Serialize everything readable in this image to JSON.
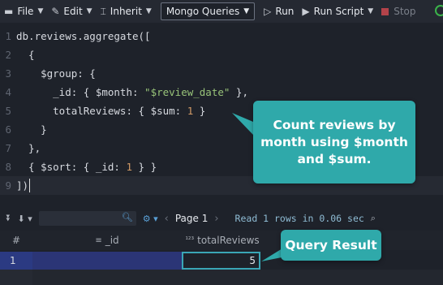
{
  "toolbar": {
    "file_label": "File",
    "edit_label": "Edit",
    "inherit_label": "Inherit",
    "query_mode": "Mongo Queries",
    "run_label": "Run",
    "run_script_label": "Run Script",
    "stop_label": "Stop"
  },
  "editor": {
    "lines": [
      {
        "num": "1",
        "text": "db.reviews.aggregate(["
      },
      {
        "num": "2",
        "text": "  {"
      },
      {
        "num": "3",
        "text": "    $group: {"
      },
      {
        "num": "4",
        "pre": "      _id: { $month: ",
        "str": "\"$review_date\"",
        "post": " },"
      },
      {
        "num": "5",
        "pre": "      totalReviews: { $sum: ",
        "numv": "1",
        "post": " }"
      },
      {
        "num": "6",
        "text": "    }"
      },
      {
        "num": "7",
        "text": "  },"
      },
      {
        "num": "8",
        "pre": "  { $sort: { _id: ",
        "numv": "1",
        "post": " } }"
      },
      {
        "num": "9",
        "text": "])"
      }
    ]
  },
  "results_bar": {
    "page_label": "Page 1",
    "status": "Read 1 rows in 0.06 sec"
  },
  "grid": {
    "columns": [
      "#",
      "_id",
      "totalReviews"
    ],
    "rows": [
      {
        "index": "1",
        "id": "",
        "totalReviews": "5"
      }
    ]
  },
  "callouts": {
    "code_note": "Count reviews by month using $month and $sum.",
    "result_note": "Query  Result"
  },
  "colors": {
    "callout": "#2fa9aa",
    "run_green": "#3bb34a",
    "selected_row": "#2b3a82"
  }
}
